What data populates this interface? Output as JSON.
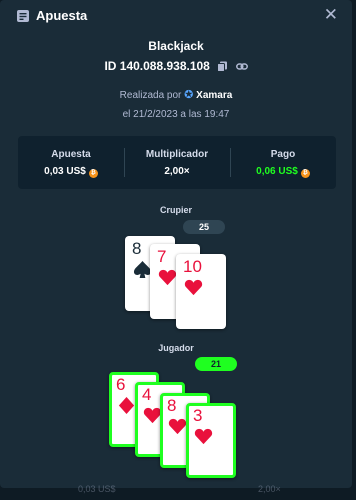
{
  "header": {
    "title": "Apuesta",
    "close_icon": "close-icon",
    "receipt_icon": "receipt-icon"
  },
  "game": {
    "title": "Blackjack",
    "bet_id": "ID 140.088.938.108",
    "made_by_label": "Realizada por",
    "user": "Xamara",
    "date": "el 21/2/2023 a las 19:47"
  },
  "stats": [
    {
      "label": "Apuesta",
      "value": "0,03 US$",
      "color": "#ffffff"
    },
    {
      "label": "Multiplicador",
      "value": "2,00×",
      "color": "#ffffff"
    },
    {
      "label": "Pago",
      "value": "0,06 US$",
      "color": "#1fff20"
    }
  ],
  "coin_glyph": "₿",
  "dealer": {
    "label": "Crupier",
    "score": "25",
    "cards": [
      {
        "rank": "8",
        "suit": "spade",
        "color": "black"
      },
      {
        "rank": "7",
        "suit": "heart",
        "color": "red"
      },
      {
        "rank": "10",
        "suit": "heart",
        "color": "red"
      }
    ]
  },
  "player": {
    "label": "Jugador",
    "score": "21",
    "cards": [
      {
        "rank": "6",
        "suit": "diamond",
        "color": "red"
      },
      {
        "rank": "4",
        "suit": "heart",
        "color": "red"
      },
      {
        "rank": "8",
        "suit": "heart",
        "color": "red"
      },
      {
        "rank": "3",
        "suit": "heart",
        "color": "red"
      }
    ]
  },
  "background_row": {
    "left": "0,03 US$",
    "right": "2,00×"
  },
  "colors": {
    "win": "#1fff20",
    "red": "#e9113c",
    "panel": "#1a2c38",
    "dark": "#0f212e"
  }
}
